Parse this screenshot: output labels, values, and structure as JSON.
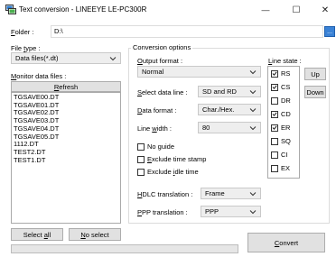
{
  "window": {
    "title": "Text conversion - LINEEYE LE-PC300R",
    "min_glyph": "—",
    "max_glyph": "☐",
    "close_glyph": "✕"
  },
  "folder": {
    "label": "Folder :",
    "value": "D:\\",
    "browse_label": "..."
  },
  "file_type": {
    "label": "File type :",
    "selected": "Data files(*.dt)"
  },
  "monitor": {
    "label": "Monitor data files :",
    "refresh_label": "Refresh",
    "files": [
      "TGSAVE00.DT",
      "TGSAVE01.DT",
      "TGSAVE02.DT",
      "TGSAVE03.DT",
      "TGSAVE04.DT",
      "TGSAVE05.DT",
      "1112.DT",
      "TEST2.DT",
      "TEST1.DT"
    ]
  },
  "buttons": {
    "select_all": "Select all",
    "no_select": "No select",
    "convert": "Convert"
  },
  "conversion": {
    "group_label": "Conversion options",
    "output_format_label": "Output format :",
    "output_format_value": "Normal",
    "select_data_line_label": "Select data line :",
    "select_data_line_value": "SD and RD",
    "data_format_label": "Data format :",
    "data_format_value": "Char./Hex.",
    "line_width_label": "Line width :",
    "line_width_value": "80",
    "no_guide_label": "No guide",
    "exclude_time_stamp_label": "Exclude time stamp",
    "exclude_idle_time_label": "Exclude idle time",
    "hdlc_label": "HDLC translation :",
    "hdlc_value": "Frame",
    "ppp_label": "PPP translation :",
    "ppp_value": "PPP"
  },
  "line_state": {
    "label": "Line state :",
    "up_label": "Up",
    "down_label": "Down",
    "items": [
      {
        "label": "RS",
        "checked": true
      },
      {
        "label": "CS",
        "checked": true
      },
      {
        "label": "DR",
        "checked": false
      },
      {
        "label": "CD",
        "checked": true
      },
      {
        "label": "ER",
        "checked": true
      },
      {
        "label": "SQ",
        "checked": false
      },
      {
        "label": "CI",
        "checked": false
      },
      {
        "label": "EX",
        "checked": false
      }
    ]
  },
  "colors": {
    "accent": "#0078d7",
    "button_bg": "#e1e1e1",
    "combo_bg": "#eeeeee"
  }
}
